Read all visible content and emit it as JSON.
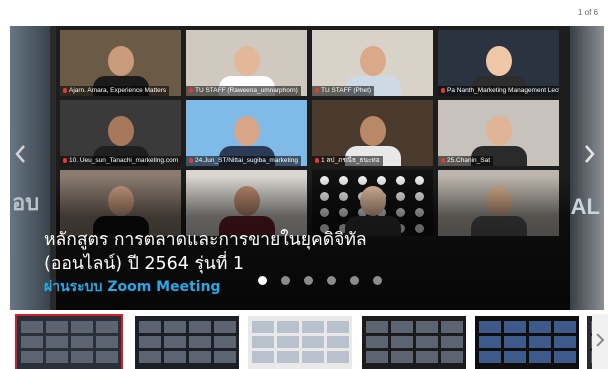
{
  "counter": "1 of 6",
  "slide": {
    "title_line1": "หลักสูตร การตลาดและการขายในยุคดิจิทัล",
    "title_line2": "(ออนไลน์) ปี 2564 รุ่นที่ 1",
    "subtitle": "ผ่านระบบ Zoom Meeting",
    "ghost_left": "อบ",
    "ghost_right": "AL"
  },
  "participants": [
    "Ajarn. Amara, Experience Matters",
    "TU STAFF (Raweena_umnarphorn)",
    "TU STAFF (Phet)",
    "Pa Nanth_Marketing Management Lecturer",
    "10. Ueu_sun_Tanachi_marketing.com",
    "24.Jun_ST/Nittai_sugiba_marketing",
    "1 ลป_ภรณีธ_ธนะทอ",
    "25.Chanin_Sat",
    "",
    "",
    "",
    ""
  ],
  "pagination": {
    "total": 6,
    "active": 0
  },
  "thumbnails": [
    "thumb-1",
    "thumb-2",
    "thumb-3",
    "thumb-4",
    "thumb-5",
    "thumb-6"
  ],
  "colors": {
    "subtitle": "#29a8e8",
    "selected_border": "#d32027",
    "muted_mic": "#e53935"
  },
  "icons": {
    "prev": "chevron-left-icon",
    "next": "chevron-right-icon"
  }
}
